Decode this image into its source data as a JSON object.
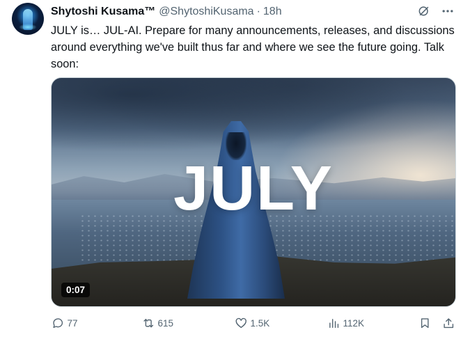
{
  "tweet": {
    "author": {
      "display_name": "Shytoshi Kusama™",
      "handle": "@ShytoshiKusama",
      "separator": "·",
      "time": "18h"
    },
    "text": "JULY is… JUL-AI. Prepare for many announcements, releases, and discussions around everything we've built thus far and where we see the future going. Talk soon:",
    "media": {
      "overlay_title": "JULY",
      "duration": "0:07"
    },
    "header_icons": [
      "grok-icon",
      "more-icon"
    ],
    "actions": {
      "replies": "77",
      "reposts": "615",
      "likes": "1.5K",
      "views": "112K"
    }
  }
}
